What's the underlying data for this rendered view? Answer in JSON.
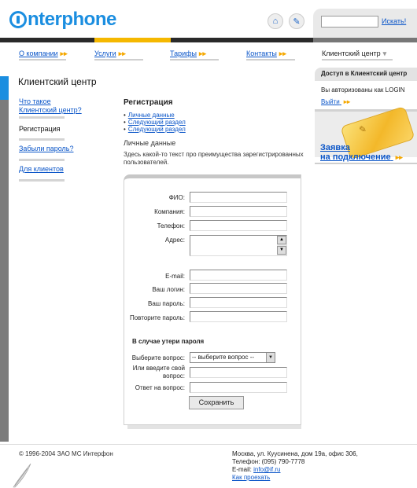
{
  "header": {
    "logo": "interphone",
    "home_icon": "home-icon",
    "edit_icon": "edit-icon",
    "search": {
      "value": "",
      "placeholder": "",
      "link": "Искать!"
    }
  },
  "nav": {
    "items": [
      {
        "label": "О компании"
      },
      {
        "label": "Услуги"
      },
      {
        "label": "Тарифы"
      },
      {
        "label": "Контакты"
      },
      {
        "label": "Клиентский центр"
      }
    ],
    "arrow": "▸▸",
    "current_arrow": "▾"
  },
  "page": {
    "title": "Клиентский центр"
  },
  "left_menu": {
    "items": [
      {
        "label": "Что такое Клиентский центр?"
      },
      {
        "label": "Регистрация"
      },
      {
        "label": "Забыли пароль?"
      },
      {
        "label": "Для клиентов"
      }
    ]
  },
  "main": {
    "section_title": "Регистрация",
    "links": [
      "Личные данные",
      "Следующий раздел",
      "Следующий раздел"
    ],
    "subtitle": "Личные данные",
    "intro": "Здесь какой-то текст про преимущества зарегистрированных пользователей.",
    "form": {
      "labels": {
        "fio": "ФИО:",
        "company": "Компания:",
        "phone": "Телефон:",
        "address": "Адрес:",
        "email": "E-mail:",
        "login": "Ваш логин:",
        "password": "Ваш пароль:",
        "password_repeat": "Повторите пароль:",
        "question": "Выберите вопрос:",
        "own_question": "Или введите свой вопрос:",
        "answer": "Ответ на вопрос:"
      },
      "lost_password_title": "В случае утери пароля",
      "question_select": "-- выберите вопрос --",
      "save_label": "Сохранить"
    }
  },
  "sidebar": {
    "access_title": "Доступ в Клиентский центр",
    "logged_in_text": "Вы авторизованы как LOGIN",
    "logout_link": "Выйти",
    "apply_line1": "Заявка",
    "apply_line2": "на подключение"
  },
  "footer": {
    "copyright": "© 1996-2004 ЗАО МС Интерфон",
    "address": "Москва, ул. Куусинена, дом 19а, офис 306,",
    "phone": "Телефон: (095) 790-7778",
    "email_label": "E-mail: ",
    "email": "info@if.ru",
    "directions": "Как проехать"
  },
  "colors": {
    "brand_blue": "#1b8ee0",
    "accent_yellow": "#f5b800",
    "link_blue": "#0a55c8"
  }
}
